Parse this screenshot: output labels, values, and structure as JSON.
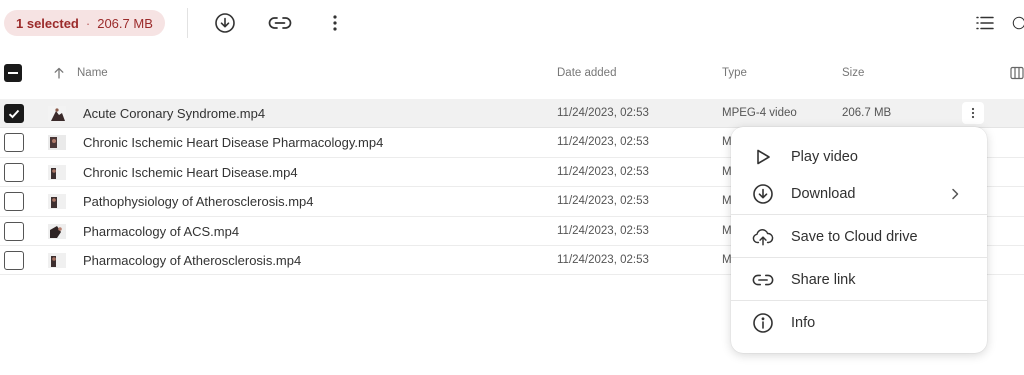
{
  "selection": {
    "count_label": "1 selected",
    "separator": "·",
    "size": "206.7 MB"
  },
  "toolbar": {
    "download_icon": "download-icon",
    "link_icon": "link-icon",
    "more_icon": "more-vertical-icon",
    "list_view_icon": "list-view-icon"
  },
  "columns": {
    "name": "Name",
    "date_added": "Date added",
    "type": "Type",
    "size": "Size",
    "sort_direction": "ascending"
  },
  "files": [
    {
      "name": "Acute Coronary Syndrome.mp4",
      "date": "11/24/2023, 02:53",
      "type": "MPEG-4 video",
      "size": "206.7 MB",
      "selected": true
    },
    {
      "name": "Chronic Ischemic Heart Disease Pharmacology.mp4",
      "date": "11/24/2023, 02:53",
      "type": "M",
      "size": "",
      "selected": false
    },
    {
      "name": "Chronic Ischemic Heart Disease.mp4",
      "date": "11/24/2023, 02:53",
      "type": "M",
      "size": "",
      "selected": false
    },
    {
      "name": "Pathophysiology of Atherosclerosis.mp4",
      "date": "11/24/2023, 02:53",
      "type": "M",
      "size": "",
      "selected": false
    },
    {
      "name": "Pharmacology of ACS.mp4",
      "date": "11/24/2023, 02:53",
      "type": "M",
      "size": "",
      "selected": false
    },
    {
      "name": "Pharmacology of Atherosclerosis.mp4",
      "date": "11/24/2023, 02:53",
      "type": "M",
      "size": "",
      "selected": false
    }
  ],
  "context_menu": {
    "items": [
      {
        "label": "Play video",
        "icon": "play-icon"
      },
      {
        "label": "Download",
        "icon": "download-icon",
        "submenu": true
      },
      {
        "label": "Save to Cloud drive",
        "icon": "cloud-upload-icon"
      },
      {
        "label": "Share link",
        "icon": "link-icon"
      },
      {
        "label": "Info",
        "icon": "info-icon"
      }
    ]
  },
  "colors": {
    "selection_pill_bg": "#f6e3e3",
    "selection_pill_text": "#9b2b2b",
    "selected_row_bg": "#f1f1f1"
  }
}
